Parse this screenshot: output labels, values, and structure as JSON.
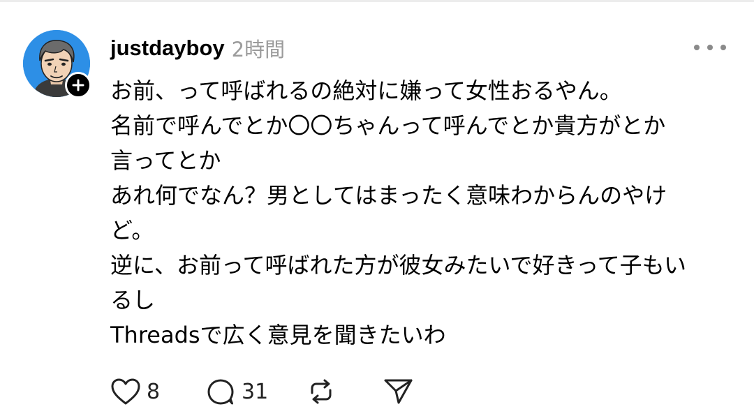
{
  "post": {
    "username": "justdayboy",
    "timestamp": "2時間",
    "lines": [
      "お前、って呼ばれるの絶対に嫌って女性おるやん。",
      "名前で呼んでとか〇〇ちゃんって呼んでとか貴方がとか",
      "言ってとか",
      "あれ何でなん？男としてはまったく意味わからんのやけ",
      "ど。",
      "逆に、お前って呼ばれた方が彼女みたいで好きって子もい",
      "るし",
      "Threadsで広く意見を聞きたいわ"
    ]
  },
  "actions": {
    "like_icon": "heart-icon",
    "like_count": "8",
    "comment_icon": "comment-bubble-icon",
    "comment_count": "31",
    "repost_icon": "repost-icon",
    "share_icon": "send-icon"
  },
  "icons": {
    "follow": "plus-icon",
    "more": "more-icon"
  },
  "colors": {
    "avatar_background": "#2d8fe6",
    "timestamp": "#9b9b9b",
    "text": "#000000"
  }
}
